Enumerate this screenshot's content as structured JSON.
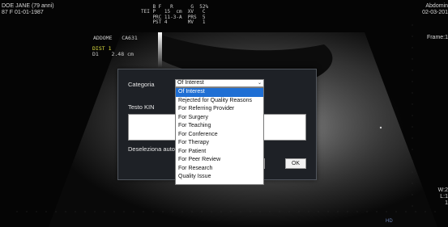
{
  "overlay": {
    "patient_name": "DOE JANE (79 anni)",
    "patient_info": "87 F 01-01-1987",
    "study_desc": "Abdomin",
    "study_date": "02-03-201",
    "frame_label": "Frame:1",
    "wl_1": "W:2",
    "wl_2": "L:1",
    "wl_3": "1",
    "acquisition": "    B F   R      G  52%\nTEI P   15  cm  XV   C\n    PRC 11-3-A  PRS  5\n    PST 4       MV   1",
    "organ": "ADDOME   CA631",
    "dist_title": "DIST 1",
    "dist_value": "D1    2.48 cm",
    "hd_label": "HD"
  },
  "dialog": {
    "category_label": "Categoria",
    "category_value": "Of Interest",
    "kin_label": "Testo KIN",
    "kin_value": "",
    "deselect_label": "Deseleziona auto",
    "cancel_label": "ulla",
    "ok_label": "OK"
  },
  "category_options": [
    "Of Interest",
    "Rejected for Quality Reasons",
    "For Referring Provider",
    "For Surgery",
    "For Teaching",
    "For Conference",
    "For Therapy",
    "For Patient",
    "For Peer Review",
    "For Research",
    "Quality Issue"
  ],
  "selected_option_index": 0,
  "colors": {
    "background": "#050505",
    "dialog_bg": "#1e2126",
    "highlight": "#1f6fd4",
    "caliper": "#e0e040"
  },
  "icons": {
    "select_chevron": "chevron-down-icon"
  }
}
